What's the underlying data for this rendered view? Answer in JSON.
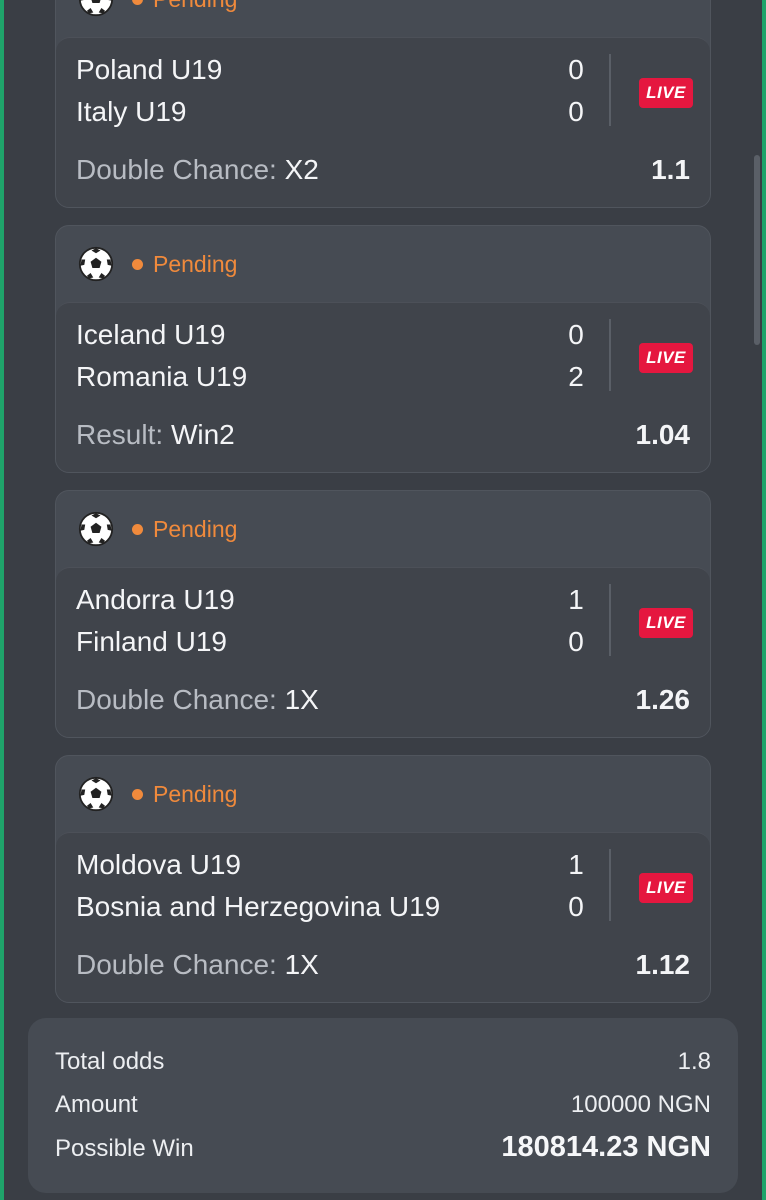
{
  "bets": [
    {
      "status": "Pending",
      "home": "Poland U19",
      "away": "Italy U19",
      "home_score": "0",
      "away_score": "0",
      "live": "LIVE",
      "market": "Double Chance:",
      "pick": "X2",
      "odd": "1.1"
    },
    {
      "status": "Pending",
      "home": "Iceland U19",
      "away": "Romania U19",
      "home_score": "0",
      "away_score": "2",
      "live": "LIVE",
      "market": "Result:",
      "pick": "Win2",
      "odd": "1.04"
    },
    {
      "status": "Pending",
      "home": "Andorra U19",
      "away": "Finland U19",
      "home_score": "1",
      "away_score": "0",
      "live": "LIVE",
      "market": "Double Chance:",
      "pick": "1X",
      "odd": "1.26"
    },
    {
      "status": "Pending",
      "home": "Moldova U19",
      "away": "Bosnia and Herzegovina U19",
      "home_score": "1",
      "away_score": "0",
      "live": "LIVE",
      "market": "Double Chance:",
      "pick": "1X",
      "odd": "1.12"
    }
  ],
  "summary": {
    "total_odds_label": "Total odds",
    "total_odds": "1.8",
    "amount_label": "Amount",
    "amount": "100000 NGN",
    "possible_win_label": "Possible Win",
    "possible_win": "180814.23 NGN"
  },
  "colors": {
    "background": "#3a3e45",
    "card": "#464b53",
    "pending": "#f08a3c",
    "live": "#e5173f",
    "edge": "#1fa36a"
  },
  "icons": {
    "sport": "soccer-ball-icon",
    "status": "status-dot-icon"
  }
}
